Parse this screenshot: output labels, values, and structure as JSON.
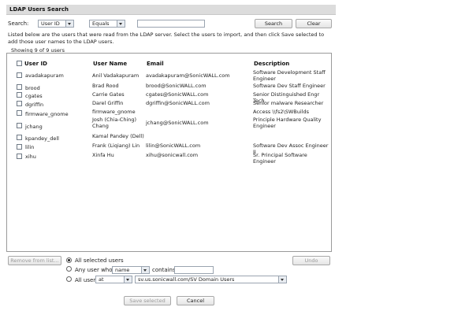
{
  "title": "LDAP Users Search",
  "search": {
    "label": "Search:",
    "field": "User ID",
    "operator": "Equals",
    "query": "",
    "search_button": "Search",
    "clear_button": "Clear"
  },
  "instructions": "Listed below are the users that were read from the LDAP server. Select the users to import, and then click Save selected to add those user names to the LDAP users.",
  "showing": "Showing 9 of 9 users",
  "columns": [
    "User ID",
    "User Name",
    "Email",
    "Description"
  ],
  "rows": [
    {
      "id": "avadakapuram",
      "name": "Anil Vadakapuram",
      "email": "avadakapuram@SonicWALL.com",
      "desc": "Software Development Staff Engineer"
    },
    {
      "id": "brood",
      "name": "Brad Rood",
      "email": "brood@SonicWALL.com",
      "desc": "Software Dev Staff Engineer"
    },
    {
      "id": "cgates",
      "name": "Carrie Gates",
      "email": "cgates@SonicWALL.com",
      "desc": "Senior Distinguished Engr Tech"
    },
    {
      "id": "dgriffin",
      "name": "Darel Griffin",
      "email": "dgriffin@SonicWALL.com",
      "desc": "Senior malware Researcher"
    },
    {
      "id": "firmware_gnome",
      "name": "firmware_gnome",
      "email": "",
      "desc": "Access \\\\fs2\\SWBuilds"
    },
    {
      "id": "jchang",
      "name": "Josh (Chia-Ching) Chang",
      "email": "jchang@SonicWALL.com",
      "desc": "Principle Hardware Quality Engineer"
    },
    {
      "id": "kpandey_dell",
      "name": "Kamal Pandey (Dell)",
      "email": "",
      "desc": ""
    },
    {
      "id": "lilin",
      "name": "Frank (Liqiang) Lin",
      "email": "lilin@SonicWALL.com",
      "desc": "Software Dev Assoc Engineer II"
    },
    {
      "id": "xihu",
      "name": "Xinfa Hu",
      "email": "xihu@sonicwall.com",
      "desc": "Sr. Principal Software Engineer"
    }
  ],
  "bottom": {
    "remove_button": "Remove from list...",
    "undo_button": "Undo",
    "opt_all_selected": "All selected users",
    "opt_any_user_whose": "Any user whose",
    "any_field": "name",
    "contains_label": "contains",
    "contains_value": "",
    "opt_all_users": "All users",
    "all_users_scope": "at",
    "all_users_path": "sv.us.sonicwall.com/SV Domain Users"
  },
  "save_button": "Save selected",
  "cancel_button": "Cancel"
}
